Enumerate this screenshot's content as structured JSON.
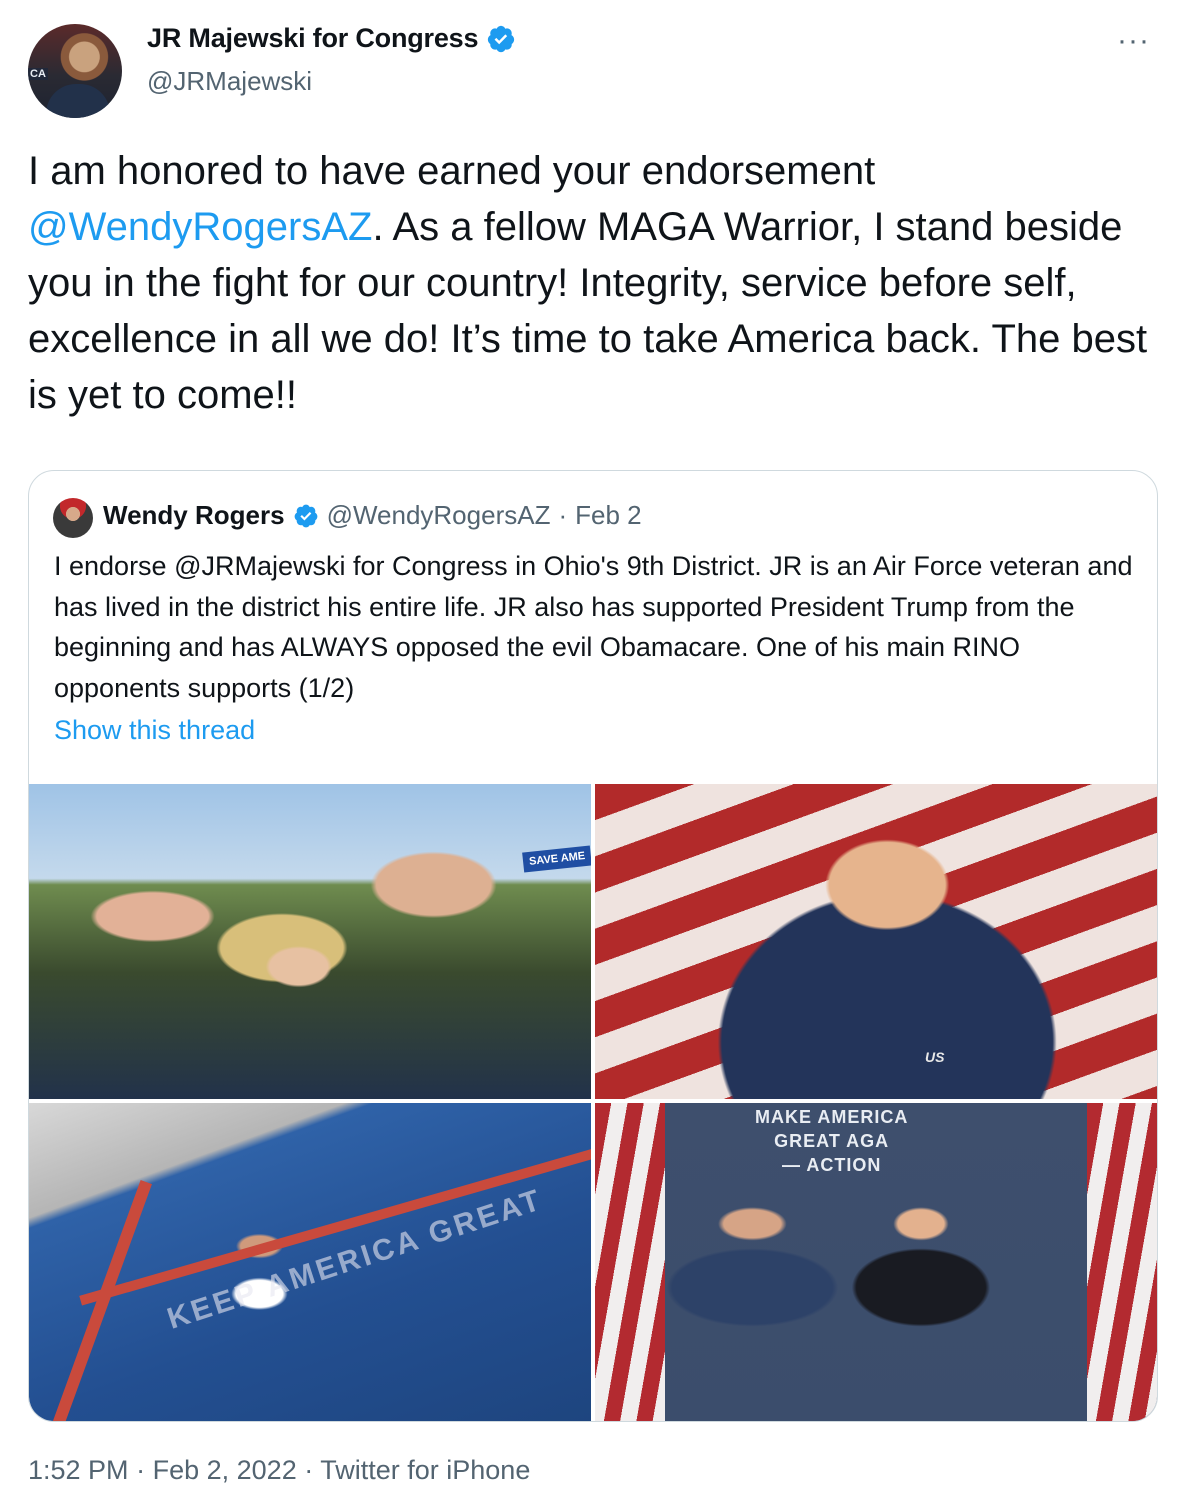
{
  "author": {
    "display_name": "JR Majewski for Congress",
    "handle": "@JRMajewski",
    "avatar_badge": "CA",
    "verified": true
  },
  "tweet": {
    "text_before": "I am honored to have earned your endorsement ",
    "mention": "@WendyRogersAZ",
    "text_after": ". As a fellow MAGA Warrior, I stand beside you in the fight for our country! Integrity, service before self, excellence in all we do! It’s time to take America back. The best is yet to come!!"
  },
  "more_label": "···",
  "quoted_tweet": {
    "name": "Wendy Rogers",
    "handle": "@WendyRogersAZ",
    "separator": "·",
    "date": "Feb 2",
    "text": "I endorse @JRMajewski for Congress in Ohio's 9th District. JR is an Air Force veteran and has lived in the district his entire life. JR also has supported President Trump from the beginning and has ALWAYS opposed the evil Obamacare. One of his main RINO opponents supports (1/2)",
    "show_thread": "Show this thread",
    "media": {
      "photo1_sign": "SAVE AME",
      "photo2_patch": "US",
      "photo3_paint": "KEEP AMERICA GREAT",
      "photo4_banner_line1": "MAKE AMERICA",
      "photo4_banner_line2": "GREAT AGA",
      "photo4_banner_line3": "— ACTION"
    }
  },
  "footer": {
    "time": "1:52 PM",
    "date": "Feb 2, 2022",
    "source": "Twitter for iPhone",
    "separator": "·"
  },
  "colors": {
    "accent": "#1d9bf0",
    "secondary_text": "#536471",
    "border": "#cfd9de"
  }
}
